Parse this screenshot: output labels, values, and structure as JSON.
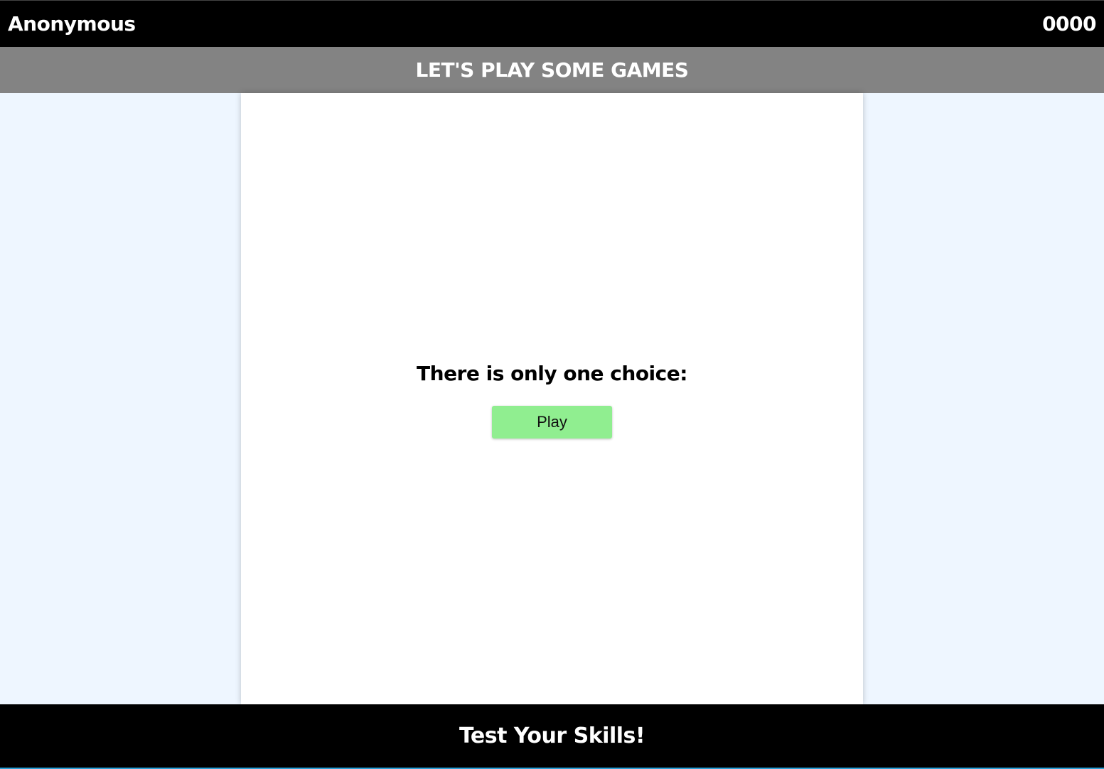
{
  "header": {
    "username": "Anonymous",
    "score": "0000"
  },
  "banner": {
    "title": "LET'S PLAY SOME GAMES"
  },
  "main": {
    "prompt": "There is only one choice:",
    "play_label": "Play",
    "play_color": "#90ee90"
  },
  "footer": {
    "tagline": "Test Your Skills!"
  }
}
